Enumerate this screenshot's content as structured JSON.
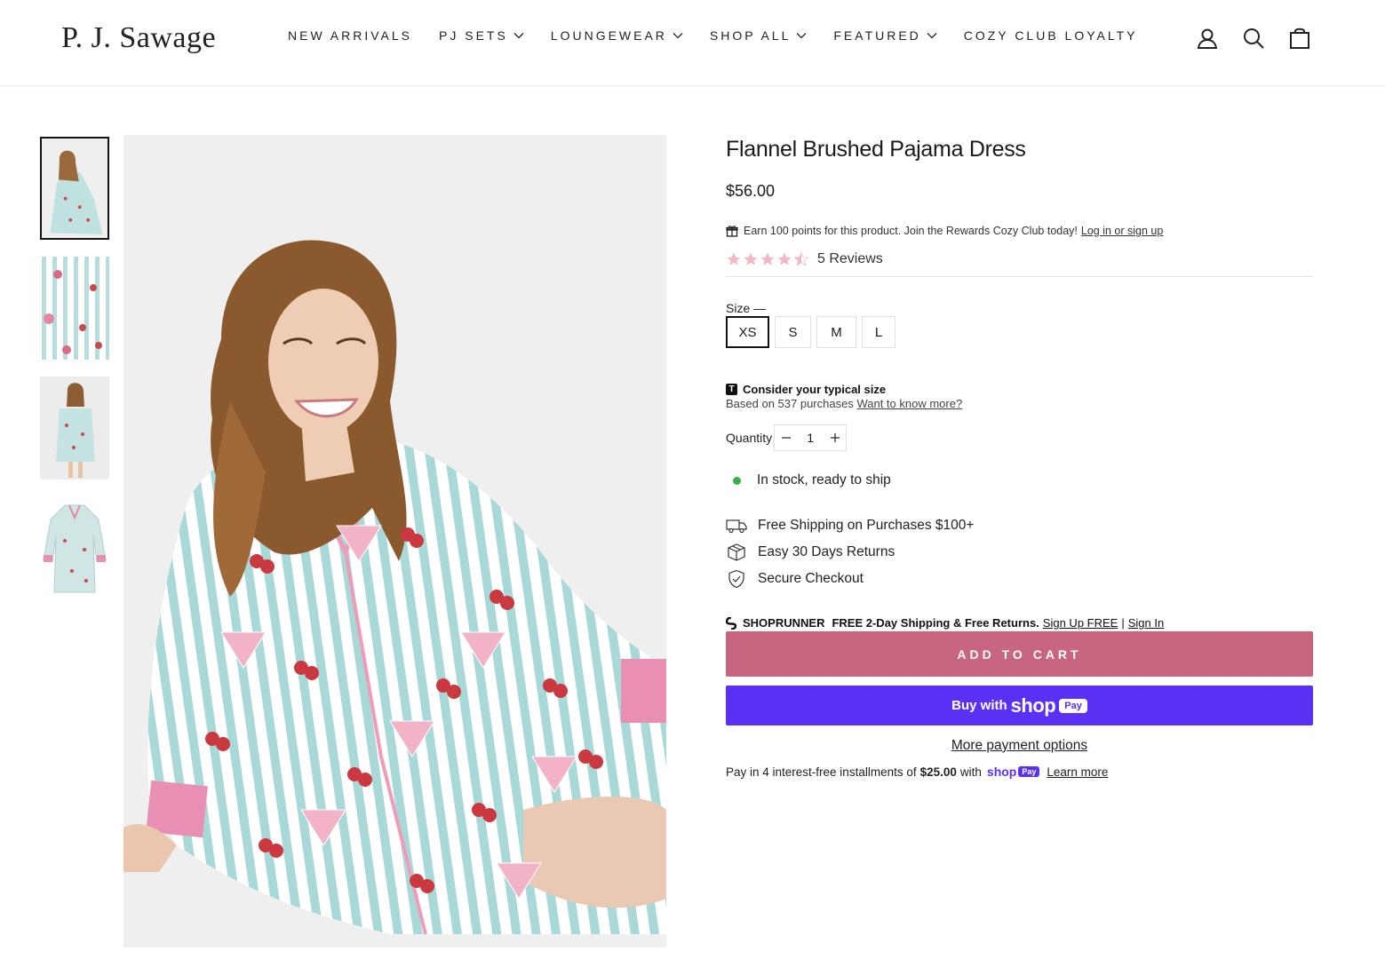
{
  "brand": {
    "logo_text": "P. J. Sawage"
  },
  "nav": {
    "items": [
      {
        "label": "NEW ARRIVALS",
        "dropdown": false
      },
      {
        "label": "PJ SETS",
        "dropdown": true
      },
      {
        "label": "LOUNGEWEAR",
        "dropdown": true
      },
      {
        "label": "SHOP ALL",
        "dropdown": true
      },
      {
        "label": "FEATURED",
        "dropdown": true
      },
      {
        "label": "COZY CLUB LOYALTY",
        "dropdown": false
      }
    ]
  },
  "header_icons": [
    "account-icon",
    "search-icon",
    "cart-icon"
  ],
  "gallery": {
    "thumbnails": [
      "model-sitting",
      "fabric-closeup",
      "model-standing",
      "flat-lay"
    ],
    "selected_index": 0
  },
  "product": {
    "title": "Flannel Brushed Pajama Dress",
    "price": "$56.00",
    "rewards_text": "Earn 100 points for this product. Join the Rewards Cozy Club today!",
    "rewards_link": "Log in or sign up",
    "rating": 4.5,
    "reviews_text": "5 Reviews",
    "size_label": "Size —",
    "sizes": [
      "XS",
      "S",
      "M",
      "L"
    ],
    "selected_size": "XS",
    "typical_size_title": "Consider your typical size",
    "typical_size_badge": "T",
    "typical_size_sub": "Based on 537 purchases",
    "typical_size_link": "Want to know more?",
    "quantity_label": "Quantity",
    "quantity": "1",
    "stock_text": "In stock, ready to ship",
    "perks": [
      {
        "icon": "truck-icon",
        "text": "Free Shipping on Purchases $100+"
      },
      {
        "icon": "box-icon",
        "text": "Easy 30 Days Returns"
      },
      {
        "icon": "shield-check-icon",
        "text": "Secure Checkout"
      }
    ],
    "shoprunner": {
      "brand": "SHOPRUNNER",
      "offer": "FREE 2-Day Shipping & Free Returns.",
      "signup": "Sign Up FREE",
      "separator": "|",
      "signin": "Sign In"
    },
    "add_to_cart": "ADD TO CART",
    "shoppay_prefix": "Buy with",
    "shoppay_brand": "shop",
    "shoppay_pay": "Pay",
    "more_payment": "More payment options",
    "installments_prefix": "Pay in 4 interest-free installments of",
    "installments_amount": "$25.00",
    "installments_with": "with",
    "installments_learn": "Learn more"
  },
  "colors": {
    "accent": "#c8657f",
    "shoppay": "#5a31f4",
    "stock_dot": "#3bb143",
    "star": "#f1b7c5"
  }
}
